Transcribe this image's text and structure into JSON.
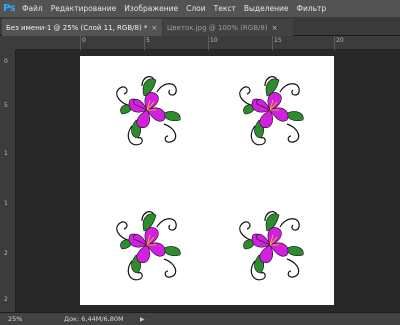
{
  "app": {
    "logo": "Ps"
  },
  "menu": [
    "Файл",
    "Редактирование",
    "Изображение",
    "Слои",
    "Текст",
    "Выделение",
    "Фильтр"
  ],
  "tabs": [
    {
      "label": "Без имени-1 @ 25% (Слой 11, RGB/8) *",
      "close": "×"
    },
    {
      "label": "Цветок.jpg @ 100% (RGB/8)",
      "close": "×"
    }
  ],
  "ruler_h_labels": [
    "0",
    "5",
    "10",
    "15",
    "20"
  ],
  "ruler_v_labels": [
    "0",
    "5",
    "1",
    "1",
    "2",
    "2"
  ],
  "status": {
    "zoom": "25%",
    "doc": "Док: 6,44M/6,80M",
    "arrow": "▶"
  },
  "colors": {
    "petal": "#d21fe0",
    "leaf": "#2e8b2e",
    "swirl": "#111111",
    "canvas": "#ffffff"
  }
}
